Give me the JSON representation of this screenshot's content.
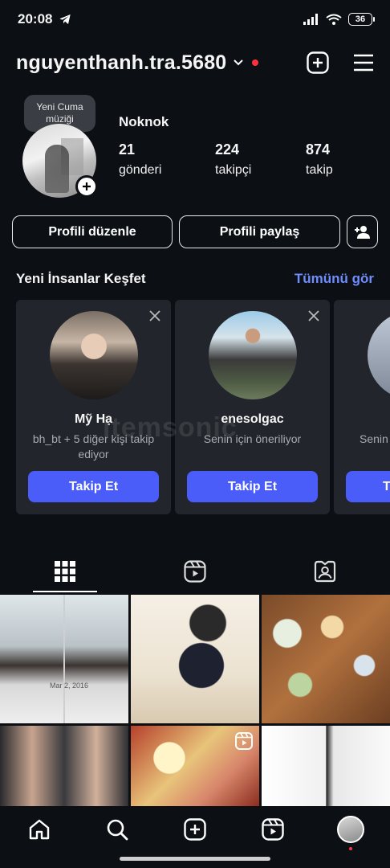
{
  "status": {
    "time": "20:08",
    "battery": "36"
  },
  "header": {
    "username": "nguyenthanh.tra.5680",
    "notification_dot_color": "#ff3040"
  },
  "profile": {
    "note_tooltip": "Yeni Cuma müziği",
    "display_name": "Noknok",
    "stats": [
      {
        "value": "21",
        "label": "gönderi"
      },
      {
        "value": "224",
        "label": "takipçi"
      },
      {
        "value": "874",
        "label": "takip"
      }
    ],
    "edit_label": "Profili düzenle",
    "share_label": "Profili paylaş"
  },
  "discover": {
    "title": "Yeni İnsanlar Keşfet",
    "see_all": "Tümünü gör",
    "cards": [
      {
        "name": "Mỹ Hạ",
        "subtitle": "bh_bt + 5 diğer kişi takip ediyor",
        "follow_label": "Takip Et"
      },
      {
        "name": "enesolgac",
        "subtitle": "Senin için öneriliyor",
        "follow_label": "Takip Et"
      },
      {
        "name": "",
        "subtitle": "Senin",
        "follow_label": "T"
      }
    ]
  },
  "grid_overlay_text": "Mar 2, 2016",
  "watermark": "itemsonic",
  "colors": {
    "accent": "#4a5df9",
    "link": "#708dff",
    "background": "#0c0f14",
    "card": "#22252b"
  },
  "tabs": [
    "grid-icon",
    "reels-icon",
    "tagged-icon"
  ],
  "bottom_nav": [
    "home-icon",
    "search-icon",
    "create-icon",
    "reels-icon",
    "profile-avatar"
  ]
}
